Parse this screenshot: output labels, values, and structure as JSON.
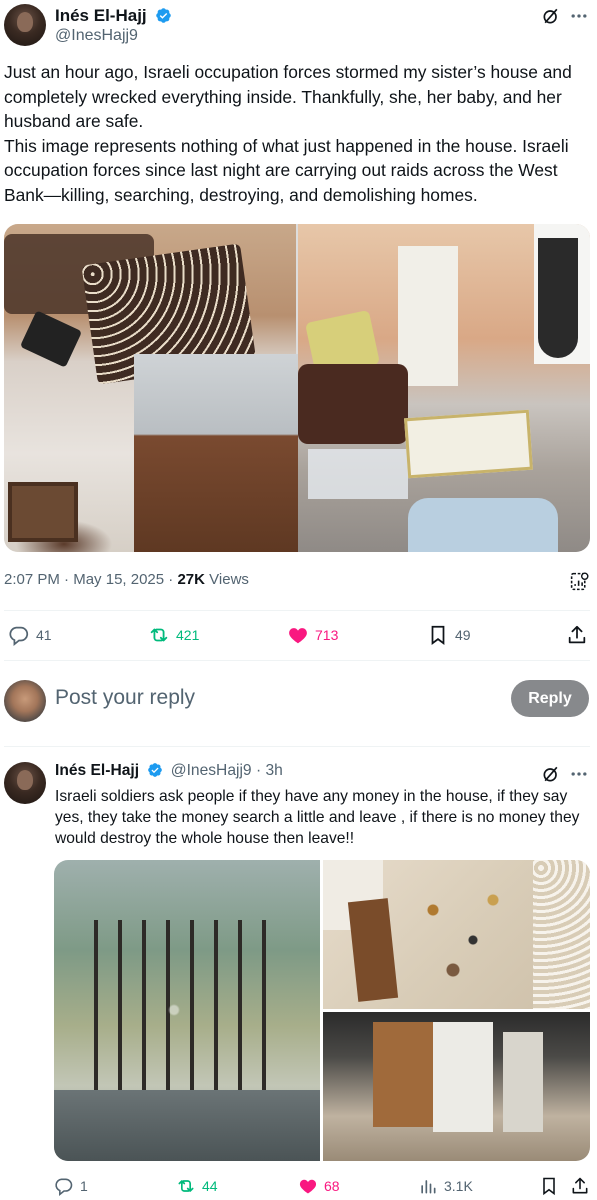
{
  "post1": {
    "author_name": "Inés El-Hajj",
    "author_handle": "@InesHajj9",
    "text": "Just an hour ago, Israeli occupation forces stormed my sister’s house and completely wrecked everything inside. Thankfully, she, her baby, and her husband are safe.\nThis image represents nothing of what just happened in the house. Israeli occupation forces since last night are carrying out raids across the West Bank—killing, searching, destroying, and demolishing homes.",
    "time": "2:07 PM",
    "date": "May 15, 2025",
    "views_count": "27K",
    "views_label": "Views",
    "replies": "41",
    "reposts": "421",
    "likes": "713",
    "bookmarks": "49"
  },
  "reply_box": {
    "placeholder": "Post your reply",
    "button_label": "Reply"
  },
  "post2": {
    "author_name": "Inés El-Hajj",
    "author_handle": "@InesHajj9",
    "age": "3h",
    "text": "Israeli soldiers ask people if they have any money in the house, if they say yes, they take the money search a little and leave , if there is no money they would destroy the whole house then leave!!",
    "replies": "1",
    "reposts": "44",
    "likes": "68",
    "views": "3.1K"
  },
  "colors": {
    "text": "#0f1419",
    "secondary": "#536471",
    "verified": "#1d9bf0",
    "repost_active": "#00ba7c",
    "like_active": "#f91880",
    "reply_button": "#87898c"
  },
  "icons": {
    "verified": "verified-badge-icon",
    "grok": "grok-icon",
    "more": "more-icon",
    "reply": "reply-icon",
    "repost": "repost-icon",
    "like": "heart-icon",
    "bookmark": "bookmark-icon",
    "share": "share-icon",
    "views": "views-icon",
    "analytics": "analytics-icon"
  }
}
